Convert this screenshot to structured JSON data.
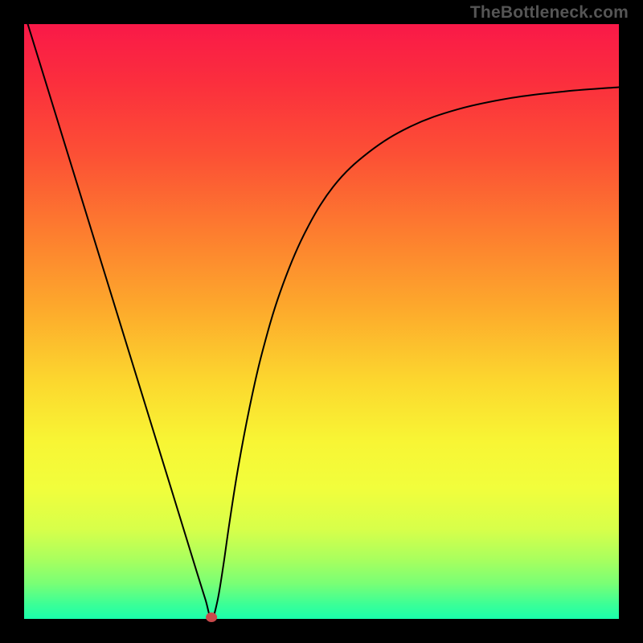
{
  "watermark": "TheBottleneck.com",
  "chart_data": {
    "type": "line",
    "title": "",
    "xlabel": "",
    "ylabel": "",
    "axes_hidden": true,
    "xlim": [
      0.0,
      1.0
    ],
    "ylim": [
      0.0,
      1.0
    ],
    "grid": false,
    "background_gradient": {
      "stops": [
        {
          "pos": 0.0,
          "color": "#f91948"
        },
        {
          "pos": 0.1,
          "color": "#fb2f3d"
        },
        {
          "pos": 0.22,
          "color": "#fc5035"
        },
        {
          "pos": 0.35,
          "color": "#fd7d2f"
        },
        {
          "pos": 0.48,
          "color": "#fdaa2c"
        },
        {
          "pos": 0.6,
          "color": "#fcd72e"
        },
        {
          "pos": 0.7,
          "color": "#f8f534"
        },
        {
          "pos": 0.78,
          "color": "#f1fe3c"
        },
        {
          "pos": 0.85,
          "color": "#d7ff4a"
        },
        {
          "pos": 0.9,
          "color": "#a9ff5e"
        },
        {
          "pos": 0.94,
          "color": "#7aff75"
        },
        {
          "pos": 0.975,
          "color": "#3cff96"
        },
        {
          "pos": 1.0,
          "color": "#1affac"
        }
      ]
    },
    "marker": {
      "x": 0.315,
      "y": 0.0,
      "color": "#c9494b"
    },
    "series": [
      {
        "name": "curve",
        "x": [
          0.0,
          0.05,
          0.1,
          0.15,
          0.2,
          0.25,
          0.29,
          0.305,
          0.315,
          0.325,
          0.335,
          0.345,
          0.36,
          0.38,
          0.4,
          0.43,
          0.47,
          0.52,
          0.58,
          0.65,
          0.73,
          0.82,
          0.91,
          1.0
        ],
        "y": [
          1.02,
          0.858,
          0.696,
          0.534,
          0.372,
          0.21,
          0.08,
          0.032,
          0.0,
          0.03,
          0.09,
          0.16,
          0.255,
          0.36,
          0.447,
          0.548,
          0.645,
          0.727,
          0.785,
          0.828,
          0.857,
          0.876,
          0.887,
          0.894
        ]
      }
    ]
  }
}
